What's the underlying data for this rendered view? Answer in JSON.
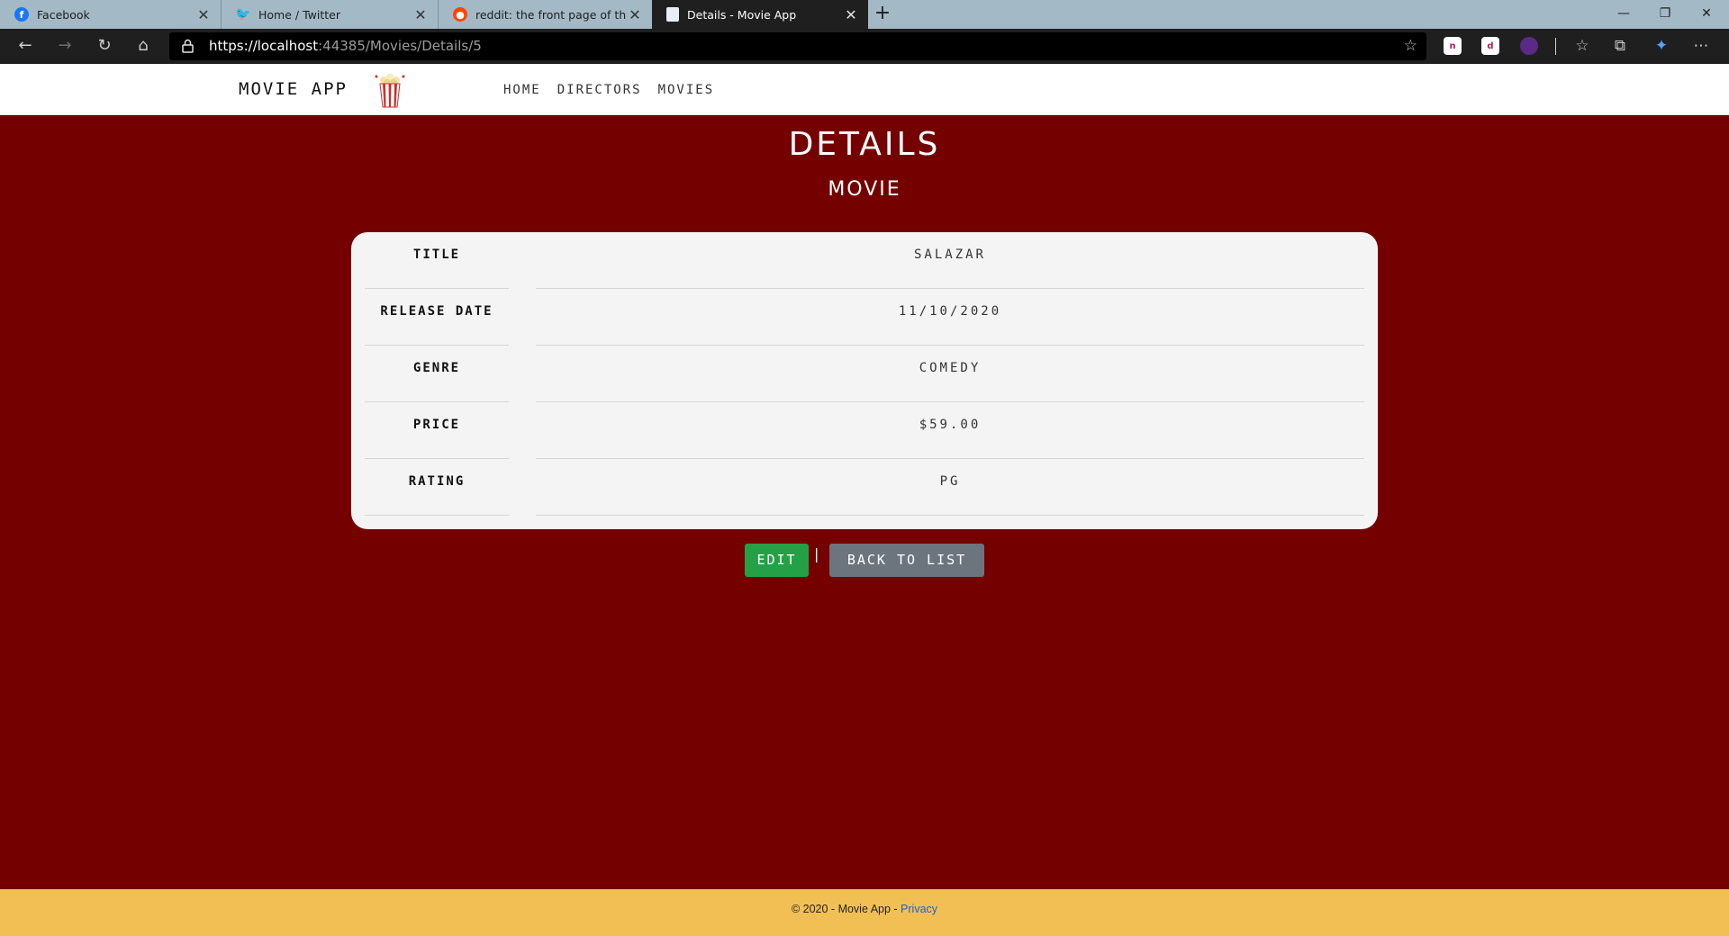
{
  "browser": {
    "tabs": [
      {
        "title": "Facebook",
        "icon": "facebook-icon",
        "color": "#1877f2"
      },
      {
        "title": "Home / Twitter",
        "icon": "twitter-icon",
        "color": "#1da1f2"
      },
      {
        "title": "reddit: the front page of the inte",
        "icon": "reddit-icon",
        "color": "#ff4500"
      },
      {
        "title": "Details - Movie App",
        "icon": "page-icon",
        "color": "#e8eef5",
        "active": true
      }
    ],
    "new_tab": "+",
    "url_host": "https://localhost",
    "url_rest": ":44385/Movies/Details/5",
    "window_controls": [
      "minimize",
      "restore",
      "close"
    ]
  },
  "site": {
    "brand": "MOVIE APP",
    "nav": [
      "HOME",
      "DIRECTORS",
      "MOVIES"
    ]
  },
  "page": {
    "heading": "DETAILS",
    "subheading": "MOVIE",
    "fields": [
      {
        "label": "TITLE",
        "value": "SALAZAR"
      },
      {
        "label": "RELEASE DATE",
        "value": "11/10/2020"
      },
      {
        "label": "GENRE",
        "value": "COMEDY"
      },
      {
        "label": "PRICE",
        "value": "$59.00"
      },
      {
        "label": "RATING",
        "value": "PG"
      }
    ],
    "edit_label": "EDIT",
    "separator": "|",
    "back_label": "BACK TO LIST"
  },
  "footer": {
    "text": "© 2020 - Movie App - ",
    "privacy": "Privacy"
  },
  "colors": {
    "page_bg": "#750000",
    "card_bg": "#f4f4f4",
    "edit_button": "#24a147",
    "back_button": "#6c757d",
    "footer_bg": "#f2bf55",
    "link": "#1d62c9"
  }
}
